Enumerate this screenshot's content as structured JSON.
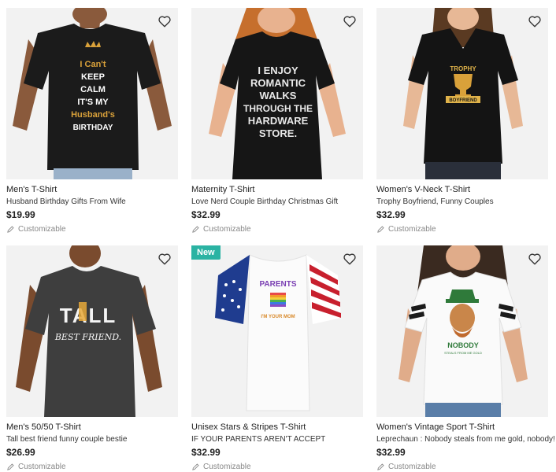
{
  "products": [
    {
      "type": "Men's T-Shirt",
      "title": "Husband Birthday Gifts From Wife",
      "price": "$19.99",
      "customizable": "Customizable",
      "design": [
        "I Can't",
        "KEEP",
        "CALM",
        "IT'S MY",
        "Husband's",
        "BIRTHDAY"
      ]
    },
    {
      "type": "Maternity T-Shirt",
      "title": "Love Nerd Couple Birthday Christmas Gift",
      "price": "$32.99",
      "customizable": "Customizable",
      "design": [
        "I ENJOY",
        "ROMANTIC",
        "WALKS",
        "THROUGH THE",
        "HARDWARE",
        "STORE."
      ]
    },
    {
      "type": "Women's V-Neck T-Shirt",
      "title": "Trophy Boyfriend, Funny Couples",
      "price": "$32.99",
      "customizable": "Customizable",
      "design": [
        "TROPHY",
        "BOYFRIEND"
      ]
    },
    {
      "type": "Men's 50/50 T-Shirt",
      "title": "Tall best friend funny couple bestie",
      "price": "$26.99",
      "customizable": "Customizable",
      "design": [
        "TALL",
        "BEST FRIEND."
      ]
    },
    {
      "type": "Unisex Stars & Stripes T-Shirt",
      "title": "IF YOUR PARENTS AREN'T ACCEPT",
      "price": "$32.99",
      "customizable": "Customizable",
      "badge": "New",
      "design": [
        "PARENTS",
        "I'M YOUR MOM"
      ]
    },
    {
      "type": "Women's Vintage Sport T-Shirt",
      "title": "Leprechaun : Nobody steals from me gold, nobody!",
      "price": "$32.99",
      "customizable": "Customizable",
      "design": [
        "NOBODY",
        "STEALS FROM ME GOLD"
      ]
    }
  ],
  "colors": {
    "badge": "#2bb3a3",
    "image_bg": "#f2f2f2",
    "gold": "#d9a13a"
  },
  "icons": {
    "favorite": "heart-outline-icon",
    "customize": "pencil-icon"
  }
}
